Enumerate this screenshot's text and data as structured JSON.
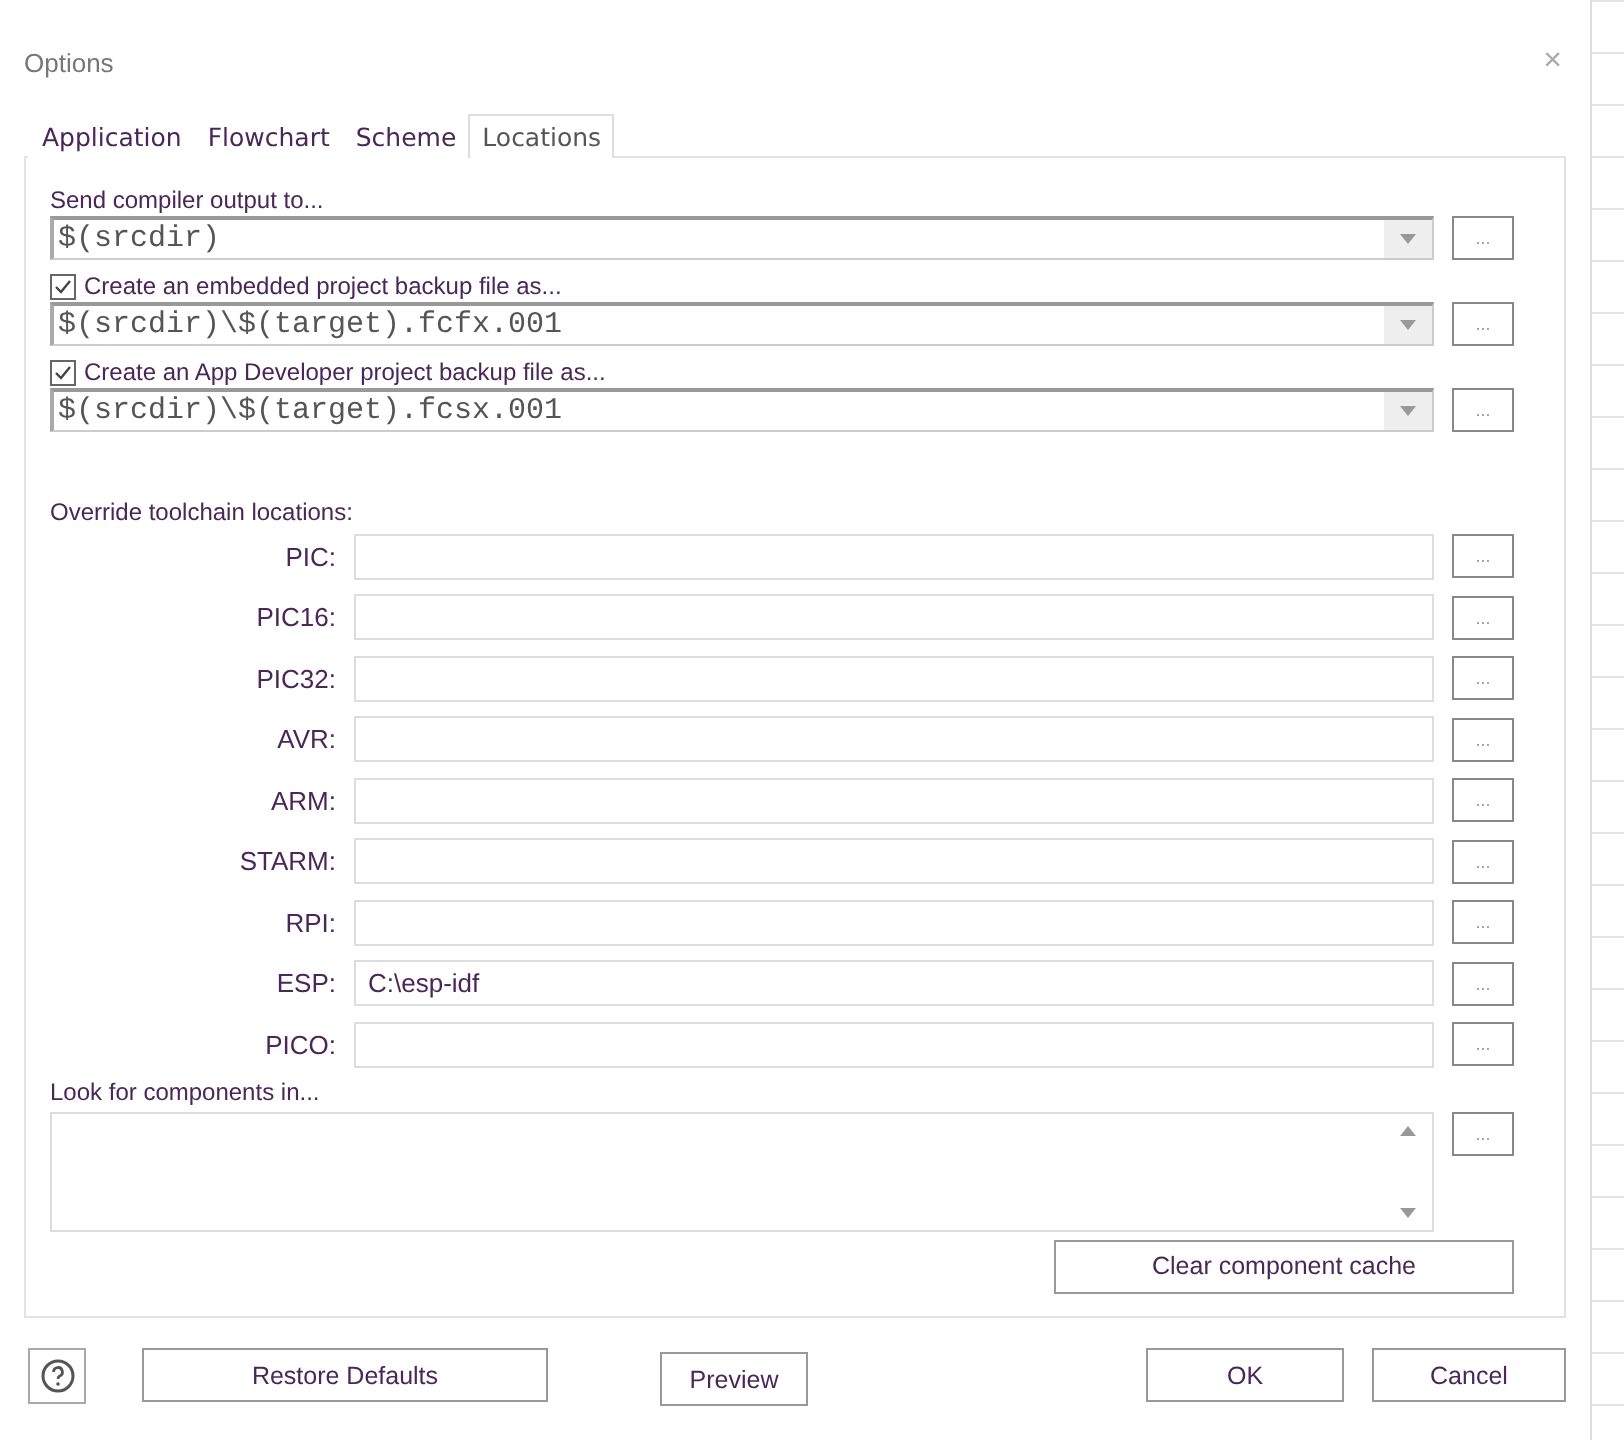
{
  "window": {
    "title": "Options",
    "close": "×"
  },
  "tabs": [
    {
      "label": "Application",
      "selected": false
    },
    {
      "label": "Flowchart",
      "selected": false
    },
    {
      "label": "Scheme",
      "selected": false
    },
    {
      "label": "Locations",
      "selected": true
    }
  ],
  "output": {
    "label": "Send compiler output to...",
    "value": "$(srcdir)",
    "browse": "..."
  },
  "backups": [
    {
      "label": "Create an embedded project backup file as...",
      "checked": true,
      "value": "$(srcdir)\\$(target).fcfx.001",
      "browse": "..."
    },
    {
      "label": "Create an App Developer project backup file as...",
      "checked": true,
      "value": "$(srcdir)\\$(target).fcsx.001",
      "browse": "..."
    }
  ],
  "toolchains": {
    "heading": "Override toolchain locations:",
    "rows": [
      {
        "label": "PIC:",
        "value": "",
        "browse": "..."
      },
      {
        "label": "PIC16:",
        "value": "",
        "browse": "..."
      },
      {
        "label": "PIC32:",
        "value": "",
        "browse": "..."
      },
      {
        "label": "AVR:",
        "value": "",
        "browse": "..."
      },
      {
        "label": "ARM:",
        "value": "",
        "browse": "..."
      },
      {
        "label": "STARM:",
        "value": "",
        "browse": "..."
      },
      {
        "label": "RPI:",
        "value": "",
        "browse": "..."
      },
      {
        "label": "ESP:",
        "value": "C:\\esp-idf",
        "browse": "..."
      },
      {
        "label": "PICO:",
        "value": "",
        "browse": "..."
      }
    ]
  },
  "components": {
    "label": "Look for components in...",
    "browse": "...",
    "clear_cache": "Clear component cache"
  },
  "footer": {
    "restore": "Restore Defaults",
    "preview": "Preview",
    "ok": "OK",
    "cancel": "Cancel"
  }
}
